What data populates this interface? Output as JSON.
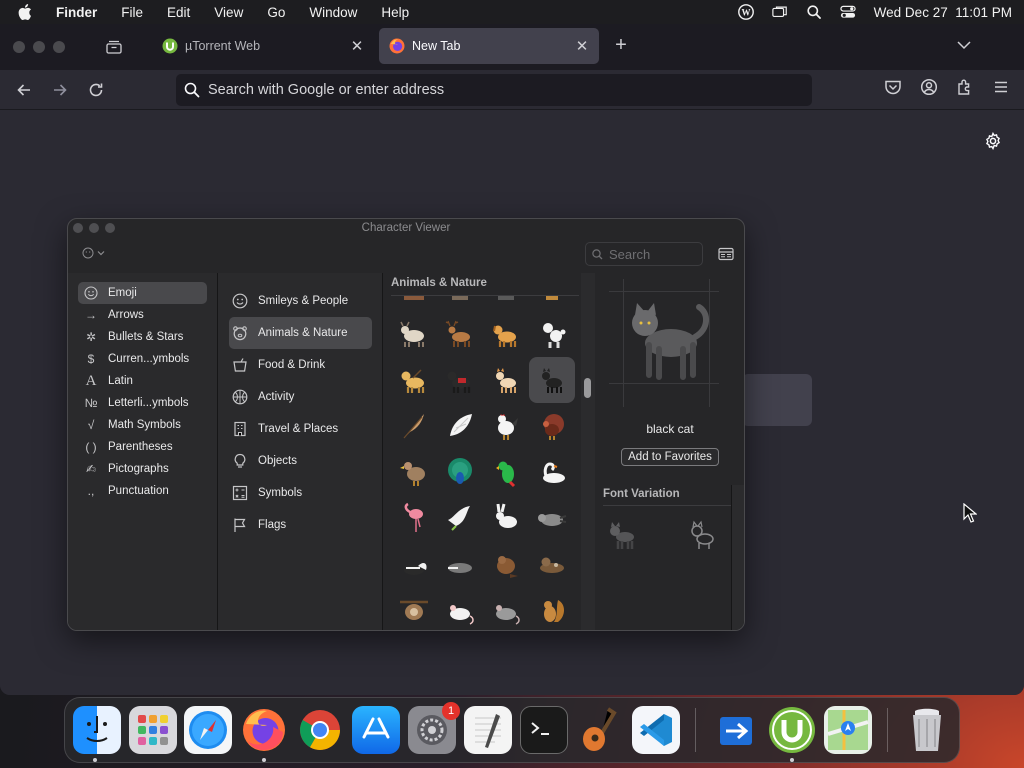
{
  "menubar": {
    "app_name": "Finder",
    "items": [
      "File",
      "Edit",
      "View",
      "Go",
      "Window",
      "Help"
    ],
    "clock": "Wed Dec 27  11:01 PM"
  },
  "browser": {
    "tabs": [
      {
        "title": "µTorrent Web",
        "active": false
      },
      {
        "title": "New Tab",
        "active": true
      }
    ],
    "url_placeholder": "Search with Google or enter address"
  },
  "character_viewer": {
    "window_title": "Character Viewer",
    "search_placeholder": "Search",
    "categories": [
      {
        "label": "Emoji",
        "icon": "smiley-icon",
        "selected": true
      },
      {
        "label": "Arrows",
        "icon": "arrow-icon"
      },
      {
        "label": "Bullets & Stars",
        "icon": "asterisk-icon"
      },
      {
        "label": "Curren...ymbols",
        "icon": "dollar-icon"
      },
      {
        "label": "Latin",
        "icon": "latin-a-icon"
      },
      {
        "label": "Letterli...ymbols",
        "icon": "numero-icon"
      },
      {
        "label": "Math Symbols",
        "icon": "sqrt-icon"
      },
      {
        "label": "Parentheses",
        "icon": "parentheses-icon"
      },
      {
        "label": "Pictographs",
        "icon": "pictograph-icon"
      },
      {
        "label": "Punctuation",
        "icon": "punctuation-icon"
      }
    ],
    "subcategories": [
      {
        "label": "Smileys & People",
        "icon": "smiley-icon"
      },
      {
        "label": "Animals & Nature",
        "icon": "bear-icon",
        "selected": true
      },
      {
        "label": "Food & Drink",
        "icon": "food-icon"
      },
      {
        "label": "Activity",
        "icon": "ball-icon"
      },
      {
        "label": "Travel & Places",
        "icon": "building-icon"
      },
      {
        "label": "Objects",
        "icon": "bulb-icon"
      },
      {
        "label": "Symbols",
        "icon": "symbols-icon"
      },
      {
        "label": "Flags",
        "icon": "flag-icon"
      }
    ],
    "grid_header": "Animals & Nature",
    "selected_character": "black cat",
    "add_favorites_label": "Add to Favorites",
    "font_variation_label": "Font Variation"
  },
  "dock": {
    "apps": [
      "finder",
      "launchpad",
      "safari",
      "firefox",
      "chrome",
      "app-store",
      "system-settings",
      "textedit",
      "terminal",
      "garageband",
      "vscode",
      "migration",
      "utorrent",
      "maps",
      "trash"
    ],
    "settings_badge": "1"
  },
  "colors": {
    "accent_blue": "#1e7cf0",
    "browser_bg": "#2b2a33",
    "cv_bg": "#262628"
  }
}
